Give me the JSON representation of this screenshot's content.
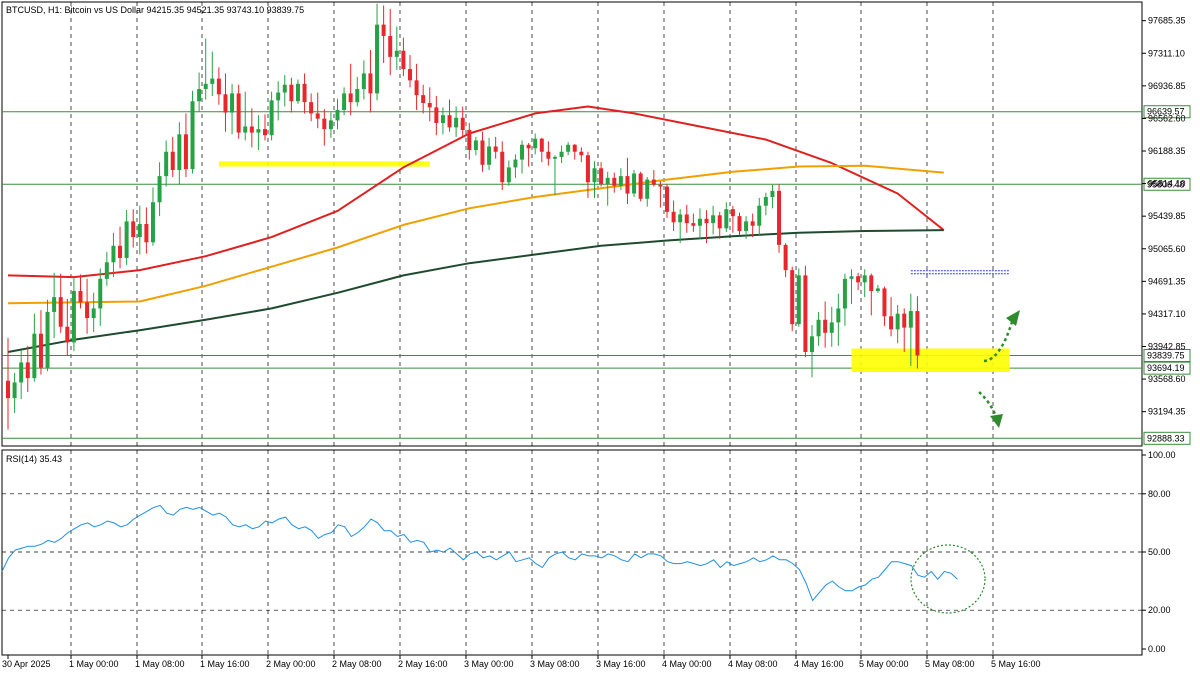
{
  "header": {
    "symbol_text": "BTCUSD, H1:  Bitcoin vs US Dollar  94215.35 94521.35 93743.10 93839.75"
  },
  "rsi_panel": {
    "label": "RSI(14) 35.43"
  },
  "chart_data": [
    {
      "type": "candlestick",
      "name": "price",
      "timeframe": "H1",
      "ylim": [
        92800,
        97900
      ],
      "y_ticks": [
        "97685.35",
        "97311.10",
        "96936.85",
        "96562.60",
        "96188.35",
        "95814.10",
        "95439.85",
        "95065.60",
        "94691.35",
        "94317.10",
        "93942.85",
        "93568.60",
        "93194.35"
      ],
      "x_ticks": [
        "30 Apr 2025",
        "1 May 00:00",
        "1 May 08:00",
        "1 May 16:00",
        "2 May 00:00",
        "2 May 08:00",
        "2 May 16:00",
        "3 May 00:00",
        "3 May 08:00",
        "3 May 16:00",
        "4 May 00:00",
        "4 May 08:00",
        "4 May 16:00",
        "5 May 00:00",
        "5 May 08:00",
        "5 May 16:00"
      ],
      "horizontal_levels": [
        {
          "value": 96639.57,
          "label": "96639.57",
          "color": "#3c8c3c"
        },
        {
          "value": 95806.48,
          "label": "95806.48",
          "color": "#3c8c3c"
        },
        {
          "value": 93839.75,
          "label": "93839.75",
          "color": "#3c8c3c"
        },
        {
          "value": 93694.19,
          "label": "93694.19",
          "color": "#3c8c3c"
        },
        {
          "value": 92888.33,
          "label": "92888.33",
          "color": "#3c8c3c"
        }
      ],
      "zones": [
        {
          "from_bar": 32,
          "to_bar": 64,
          "low": 96010,
          "high": 96070,
          "color": "#ffff00"
        },
        {
          "from_bar": 128,
          "to_bar": 152,
          "low": 93650,
          "high": 93920,
          "color": "#ffff00"
        }
      ],
      "pending_line": {
        "from_bar": 137,
        "to_bar": 152,
        "value": 94790,
        "color": "#3040e0"
      },
      "moving_averages": [
        {
          "color": "#e02020",
          "points": [
            [
              0,
              94760
            ],
            [
              10,
              94740
            ],
            [
              20,
              94820
            ],
            [
              30,
              94980
            ],
            [
              40,
              95200
            ],
            [
              50,
              95500
            ],
            [
              60,
              96000
            ],
            [
              70,
              96390
            ],
            [
              80,
              96620
            ],
            [
              88,
              96700
            ],
            [
              95,
              96620
            ],
            [
              105,
              96470
            ],
            [
              115,
              96320
            ],
            [
              125,
              96050
            ],
            [
              135,
              95700
            ],
            [
              142,
              95280
            ]
          ]
        },
        {
          "color": "#f0a000",
          "points": [
            [
              0,
              94440
            ],
            [
              20,
              94460
            ],
            [
              30,
              94640
            ],
            [
              40,
              94860
            ],
            [
              50,
              95080
            ],
            [
              60,
              95340
            ],
            [
              70,
              95530
            ],
            [
              80,
              95660
            ],
            [
              90,
              95760
            ],
            [
              100,
              95860
            ],
            [
              110,
              95950
            ],
            [
              120,
              96010
            ],
            [
              130,
              96020
            ],
            [
              142,
              95940
            ]
          ]
        },
        {
          "color": "#1e4a2e",
          "points": [
            [
              0,
              93880
            ],
            [
              10,
              94020
            ],
            [
              20,
              94130
            ],
            [
              30,
              94250
            ],
            [
              40,
              94380
            ],
            [
              50,
              94560
            ],
            [
              60,
              94760
            ],
            [
              70,
              94900
            ],
            [
              80,
              95000
            ],
            [
              90,
              95100
            ],
            [
              100,
              95160
            ],
            [
              110,
              95210
            ],
            [
              120,
              95250
            ],
            [
              130,
              95270
            ],
            [
              142,
              95280
            ]
          ]
        }
      ],
      "candles": [
        [
          93550,
          94040,
          92990,
          93350
        ],
        [
          93350,
          93640,
          93180,
          93530
        ],
        [
          93530,
          93900,
          93340,
          93760
        ],
        [
          93760,
          93950,
          93420,
          93580
        ],
        [
          93580,
          94320,
          93540,
          94090
        ],
        [
          94090,
          94360,
          93620,
          93700
        ],
        [
          93700,
          94480,
          93660,
          94340
        ],
        [
          94340,
          94790,
          94040,
          94510
        ],
        [
          94510,
          94780,
          94100,
          94170
        ],
        [
          94170,
          94490,
          93840,
          93990
        ],
        [
          93990,
          94740,
          93890,
          94580
        ],
        [
          94580,
          94770,
          94380,
          94450
        ],
        [
          94450,
          94720,
          94090,
          94270
        ],
        [
          94270,
          94560,
          94110,
          94380
        ],
        [
          94380,
          94840,
          94180,
          94720
        ],
        [
          94720,
          95030,
          94640,
          94910
        ],
        [
          94910,
          95250,
          94740,
          95100
        ],
        [
          95100,
          95320,
          94840,
          94960
        ],
        [
          94960,
          95510,
          94880,
          95380
        ],
        [
          95380,
          95520,
          95080,
          95200
        ],
        [
          95200,
          95560,
          95000,
          95350
        ],
        [
          95350,
          95540,
          95010,
          95140
        ],
        [
          95140,
          95770,
          95100,
          95600
        ],
        [
          95600,
          96060,
          95440,
          95900
        ],
        [
          95900,
          96310,
          95780,
          96180
        ],
        [
          96180,
          96350,
          95890,
          95970
        ],
        [
          95970,
          96520,
          95800,
          96380
        ],
        [
          96380,
          96620,
          95890,
          95980
        ],
        [
          95980,
          96880,
          95930,
          96760
        ],
        [
          96760,
          97090,
          96640,
          96900
        ],
        [
          96900,
          97480,
          96780,
          96960
        ],
        [
          96960,
          97330,
          96820,
          97020
        ],
        [
          97020,
          97150,
          96720,
          96840
        ],
        [
          96840,
          97080,
          96410,
          96630
        ],
        [
          96630,
          96960,
          96380,
          96850
        ],
        [
          96850,
          96950,
          96330,
          96400
        ],
        [
          96400,
          96870,
          96310,
          96470
        ],
        [
          96470,
          96680,
          96230,
          96400
        ],
        [
          96400,
          96600,
          96200,
          96440
        ],
        [
          96440,
          96610,
          96310,
          96370
        ],
        [
          96370,
          96870,
          96310,
          96770
        ],
        [
          96770,
          96990,
          96540,
          96860
        ],
        [
          96860,
          97060,
          96700,
          96950
        ],
        [
          96950,
          97030,
          96630,
          96760
        ],
        [
          96760,
          97010,
          96730,
          96960
        ],
        [
          96960,
          97080,
          96620,
          96750
        ],
        [
          96750,
          96850,
          96530,
          96620
        ],
        [
          96620,
          96860,
          96450,
          96560
        ],
        [
          96560,
          96670,
          96250,
          96440
        ],
        [
          96440,
          96630,
          96340,
          96540
        ],
        [
          96540,
          96790,
          96440,
          96660
        ],
        [
          96660,
          96920,
          96600,
          96850
        ],
        [
          96850,
          97190,
          96600,
          96750
        ],
        [
          96750,
          97040,
          96700,
          96900
        ],
        [
          96900,
          97230,
          96780,
          97080
        ],
        [
          97080,
          97350,
          96630,
          96850
        ],
        [
          96850,
          97880,
          96770,
          97640
        ],
        [
          97640,
          97860,
          97200,
          97510
        ],
        [
          97510,
          97820,
          97060,
          97270
        ],
        [
          97270,
          97620,
          97120,
          97340
        ],
        [
          97340,
          97490,
          97050,
          97130
        ],
        [
          97130,
          97290,
          96920,
          97000
        ],
        [
          97000,
          97190,
          96660,
          96830
        ],
        [
          96830,
          96950,
          96620,
          96740
        ],
        [
          96740,
          96920,
          96530,
          96690
        ],
        [
          96690,
          96820,
          96370,
          96510
        ],
        [
          96510,
          96690,
          96380,
          96600
        ],
        [
          96600,
          96780,
          96410,
          96460
        ],
        [
          96460,
          96700,
          96350,
          96570
        ],
        [
          96570,
          96700,
          96360,
          96430
        ],
        [
          96430,
          96510,
          96090,
          96200
        ],
        [
          96200,
          96350,
          96140,
          96310
        ],
        [
          96310,
          96410,
          95950,
          96030
        ],
        [
          96030,
          96340,
          95970,
          96240
        ],
        [
          96240,
          96350,
          96100,
          96180
        ],
        [
          96180,
          96300,
          95740,
          95830
        ],
        [
          95830,
          96080,
          95790,
          96000
        ],
        [
          96000,
          96150,
          95880,
          96090
        ],
        [
          96090,
          96310,
          95930,
          96260
        ],
        [
          96260,
          96280,
          96010,
          96220
        ],
        [
          96220,
          96390,
          96150,
          96330
        ],
        [
          96330,
          96340,
          96060,
          96180
        ],
        [
          96180,
          96300,
          96020,
          96100
        ],
        [
          96100,
          96140,
          95680,
          96120
        ],
        [
          96120,
          96250,
          96050,
          96180
        ],
        [
          96180,
          96290,
          96140,
          96260
        ],
        [
          96260,
          96270,
          96090,
          96180
        ],
        [
          96180,
          96230,
          96060,
          96140
        ],
        [
          96140,
          96180,
          95650,
          95830
        ],
        [
          95830,
          96070,
          95650,
          95990
        ],
        [
          95990,
          96060,
          95780,
          95810
        ],
        [
          95810,
          95950,
          95560,
          95880
        ],
        [
          95880,
          95940,
          95710,
          95790
        ],
        [
          95790,
          95990,
          95740,
          95900
        ],
        [
          95900,
          96110,
          95580,
          95700
        ],
        [
          95700,
          95970,
          95660,
          95930
        ],
        [
          95930,
          95950,
          95610,
          95640
        ],
        [
          95640,
          95890,
          95550,
          95860
        ],
        [
          95860,
          95970,
          95780,
          95800
        ],
        [
          95800,
          95840,
          95540,
          95780
        ],
        [
          95780,
          95810,
          95420,
          95490
        ],
        [
          95490,
          95620,
          95270,
          95370
        ],
        [
          95370,
          95520,
          95130,
          95460
        ],
        [
          95460,
          95570,
          95250,
          95360
        ],
        [
          95360,
          95470,
          95260,
          95330
        ],
        [
          95330,
          95530,
          95180,
          95410
        ],
        [
          95410,
          95510,
          95130,
          95360
        ],
        [
          95360,
          95560,
          95230,
          95450
        ],
        [
          95450,
          95490,
          95180,
          95300
        ],
        [
          95300,
          95600,
          95260,
          95520
        ],
        [
          95520,
          95560,
          95250,
          95440
        ],
        [
          95440,
          95480,
          95220,
          95270
        ],
        [
          95270,
          95440,
          95180,
          95380
        ],
        [
          95380,
          95470,
          95200,
          95330
        ],
        [
          95330,
          95650,
          95220,
          95560
        ],
        [
          95560,
          95710,
          95450,
          95660
        ],
        [
          95660,
          95800,
          95530,
          95730
        ],
        [
          95730,
          95810,
          95020,
          95110
        ],
        [
          95110,
          95130,
          94740,
          94820
        ],
        [
          94820,
          94860,
          94120,
          94200
        ],
        [
          94200,
          94840,
          94170,
          94760
        ],
        [
          94760,
          94870,
          93820,
          93880
        ],
        [
          93880,
          94190,
          93590,
          94060
        ],
        [
          94060,
          94340,
          93950,
          94250
        ],
        [
          94250,
          94460,
          93930,
          94100
        ],
        [
          94100,
          94400,
          93940,
          94220
        ],
        [
          94220,
          94550,
          93950,
          94380
        ],
        [
          94380,
          94780,
          94180,
          94720
        ],
        [
          94720,
          94830,
          94430,
          94750
        ],
        [
          94750,
          94790,
          94590,
          94680
        ],
        [
          94680,
          94830,
          94510,
          94760
        ],
        [
          94760,
          94780,
          94300,
          94580
        ],
        [
          94580,
          94650,
          94560,
          94610
        ],
        [
          94610,
          94630,
          94180,
          94290
        ],
        [
          94290,
          94510,
          94060,
          94140
        ],
        [
          94140,
          94420,
          93980,
          94320
        ],
        [
          94320,
          94380,
          93880,
          94160
        ],
        [
          94160,
          94550,
          93720,
          94350
        ],
        [
          94350,
          94520,
          93690,
          93840
        ]
      ]
    },
    {
      "type": "line",
      "name": "rsi",
      "ylim": [
        0,
        100
      ],
      "y_ticks": [
        "100.00",
        "80.00",
        "50.00",
        "20.00",
        "0.00"
      ],
      "levels": [
        80,
        50,
        20
      ],
      "values": [
        40,
        47,
        51,
        52,
        53,
        53,
        54,
        56,
        55,
        57,
        60,
        62,
        64,
        65,
        63,
        64,
        66,
        65,
        63,
        64,
        67,
        69,
        71,
        73,
        74,
        70,
        69,
        72,
        73,
        72,
        73,
        71,
        69,
        70,
        68,
        64,
        63,
        64,
        62,
        63,
        66,
        65,
        67,
        68,
        64,
        62,
        63,
        61,
        57,
        59,
        60,
        64,
        63,
        58,
        60,
        63,
        67,
        65,
        61,
        61,
        58,
        59,
        55,
        56,
        55,
        50,
        51,
        50,
        52,
        49,
        46,
        49,
        50,
        47,
        48,
        46,
        48,
        50,
        45,
        46,
        47,
        44,
        42,
        47,
        49,
        50,
        47,
        46,
        49,
        48,
        48,
        47,
        49,
        48,
        46,
        45,
        49,
        47,
        49,
        49,
        48,
        45,
        44,
        44,
        45,
        44,
        43,
        44,
        46,
        42,
        45,
        43,
        44,
        45,
        47,
        45,
        46,
        48,
        46,
        46,
        44,
        41,
        34,
        25,
        29,
        33,
        35,
        32,
        30,
        30,
        32,
        33,
        36,
        37,
        41,
        45,
        45,
        44,
        43,
        38,
        37,
        40,
        36,
        40,
        39,
        36
      ]
    }
  ]
}
